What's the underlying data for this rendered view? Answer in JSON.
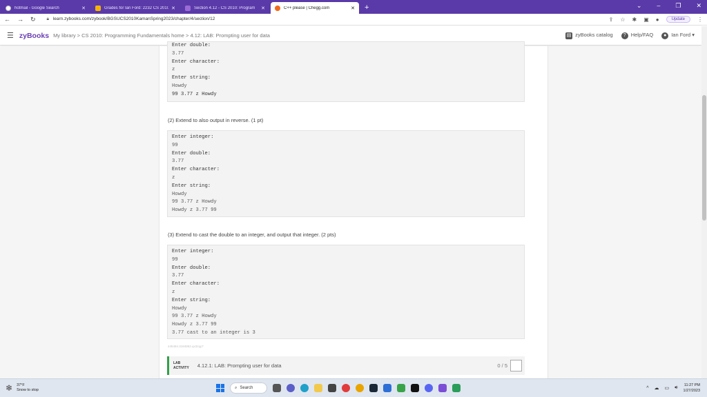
{
  "tabs": [
    {
      "title": "hotmail - Google Search",
      "color": "#ffffff"
    },
    {
      "title": "Grades for Ian Ford: 2232 CS 2010",
      "color": "#f5b400"
    },
    {
      "title": "Section 4.12 - CS 2010: Program",
      "color": "#9b6bd6"
    },
    {
      "title": "C++ please | Chegg.com",
      "color": "#f06a1d"
    }
  ],
  "address": {
    "url": "learn.zybooks.com/zybook/BGSUCS2010KamanSpring2023/chapter/4/section/12",
    "update_label": "Update"
  },
  "zybooks": {
    "logo": "zyBooks",
    "breadcrumb": "My library > CS 2010: Programming Fundamentals home > 4.12: LAB: Prompting user for data",
    "catalog": "zyBooks catalog",
    "help": "Help/FAQ",
    "user": "Ian Ford"
  },
  "content": {
    "block1": [
      "Enter double:",
      "3.77",
      "Enter character:",
      "z",
      "Enter string:",
      "Howdy",
      "99 3.77 z Howdy"
    ],
    "instr2": "(2) Extend to also output in reverse. (1 pt)",
    "block2": [
      "Enter integer:",
      "99",
      "Enter double:",
      "3.77",
      "Enter character:",
      "z",
      "Enter string:",
      "Howdy",
      "99 3.77 z Howdy",
      "Howdy z 3.77 99"
    ],
    "instr3": "(3) Extend to cast the double to an integer, and output that integer. (2 pts)",
    "block3": [
      "Enter integer:",
      "99",
      "Enter double:",
      "3.77",
      "Enter character:",
      "z",
      "Enter string:",
      "Howdy",
      "99 3.77 z Howdy",
      "Howdy z 3.77 99",
      "3.77 cast to an integer is 3"
    ],
    "faint_id": "445484.3184862.qx3zqy7",
    "lab_tag_line1": "LAB",
    "lab_tag_line2": "ACTIVITY",
    "lab_name": "4.12.1: LAB: Prompting user for data",
    "lab_score": "0 / 5"
  },
  "taskbar": {
    "weather_temp": "37°F",
    "weather_desc": "Snow to stop",
    "search_label": "Search",
    "time": "11:27 PM",
    "date": "1/27/2023"
  }
}
